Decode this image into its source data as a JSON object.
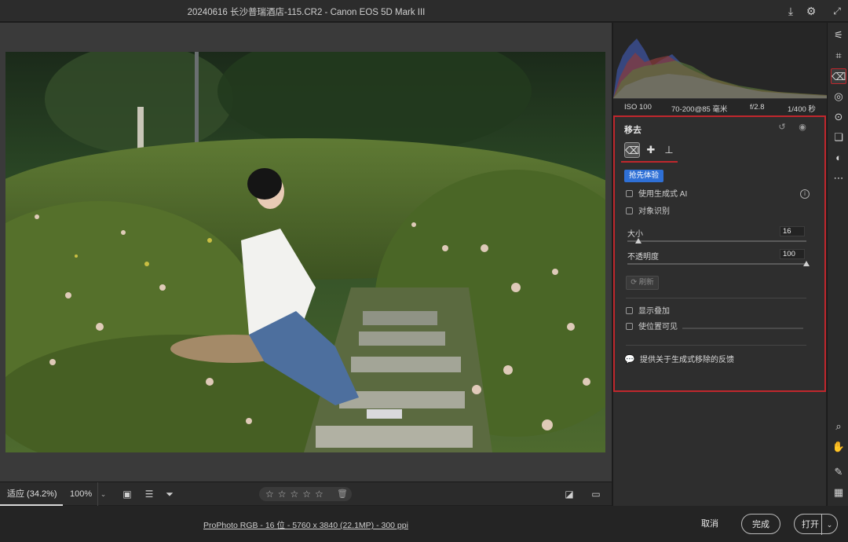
{
  "window": {
    "title": "20240616 长沙普瑞酒店-115.CR2 -  Canon EOS 5D Mark III"
  },
  "exif": {
    "iso": "ISO 100",
    "lens": "70-200@85 毫米",
    "aperture": "f/2.8",
    "shutter": "1/400 秒"
  },
  "remove_panel": {
    "title": "移去",
    "badge": "抢先体验",
    "generative_ai_label": "使用生成式 AI",
    "object_detect_label": "对象识别",
    "size_label": "大小",
    "size_value": "16",
    "size_fraction": 0.06,
    "opacity_label": "不透明度",
    "opacity_value": "100",
    "opacity_fraction": 1.0,
    "refresh_label": "刷新",
    "show_overlay_label": "显示叠加",
    "visualize_spots_label": "使位置可见",
    "feedback_label": "提供关于生成式移除的反馈"
  },
  "bottombar": {
    "zoom_fit": "适应 (34.2%)",
    "zoom_100": "100%",
    "stars": "☆☆☆☆☆"
  },
  "footer": {
    "info": "ProPhoto RGB - 16 位 - 5760 x 3840 (22.1MP) - 300 ppi",
    "cancel": "取消",
    "done": "完成",
    "open": "打开"
  },
  "icons": {
    "accent": "#c0272d",
    "badge_color": "#2f70d6"
  }
}
